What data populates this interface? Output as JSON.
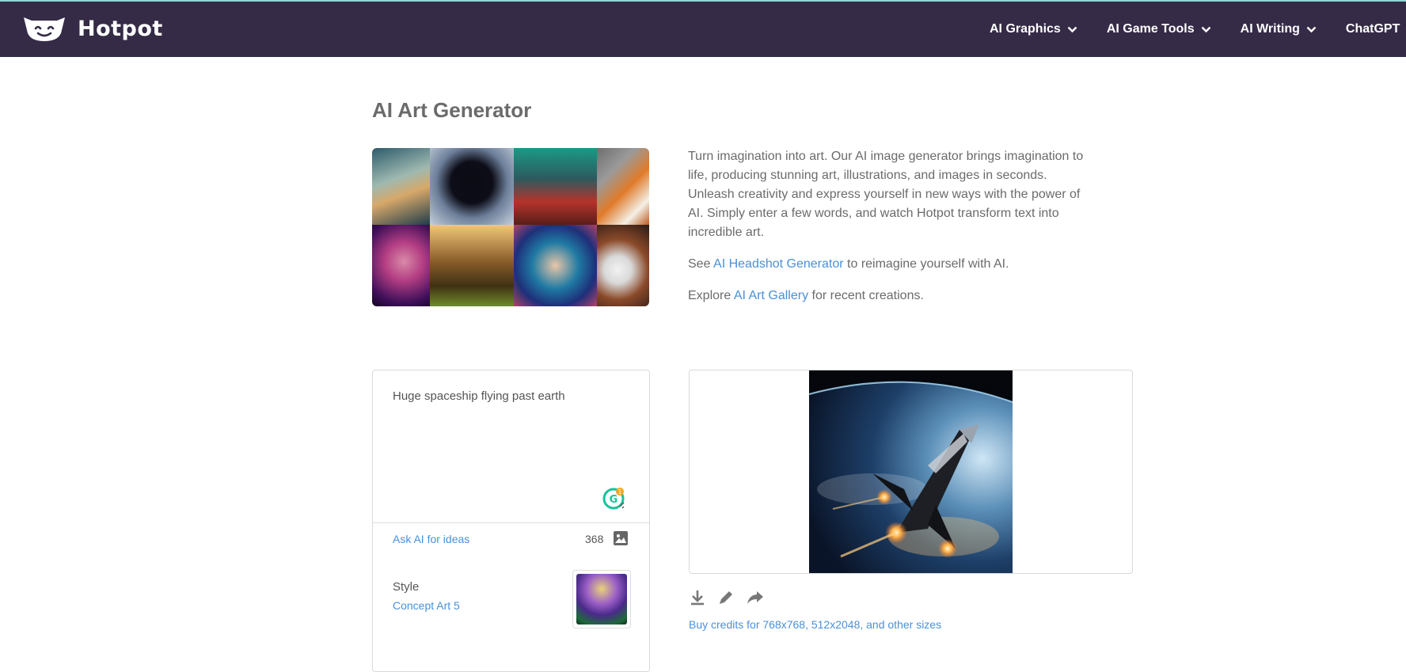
{
  "nav": {
    "brand": "Hotpot",
    "items": [
      {
        "label": "AI Graphics"
      },
      {
        "label": "AI Game Tools"
      },
      {
        "label": "AI Writing"
      },
      {
        "label": "ChatGPT"
      }
    ]
  },
  "page": {
    "title": "AI Art Generator",
    "description": "Turn imagination into art. Our AI image generator brings imagination to life, producing stunning art, illustrations, and images in seconds. Unleash creativity and express yourself in new ways with the power of AI. Simply enter a few words, and watch Hotpot transform text into incredible art.",
    "see_prefix": "See ",
    "see_link": "AI Headshot Generator",
    "see_suffix": " to reimagine yourself with AI.",
    "explore_prefix": "Explore ",
    "explore_link": "AI Art Gallery",
    "explore_suffix": " for recent creations."
  },
  "prompt": {
    "text": "Huge spaceship flying past earth",
    "ask_ai": "Ask AI for ideas",
    "char_count": "368",
    "grammarly_badge": "1",
    "style_label": "Style",
    "style_value": "Concept Art 5"
  },
  "result": {
    "buy_credits": "Buy credits for 768x768, 512x2048, and other sizes"
  },
  "icons": {
    "nav_chevron": "chevron-down-icon",
    "upload": "image-icon",
    "download": "download-icon",
    "edit": "pencil-icon",
    "share": "share-icon"
  },
  "colors": {
    "nav_bg": "#352b47",
    "link": "#4a90d9",
    "top_accent": "#8fd6d6"
  }
}
